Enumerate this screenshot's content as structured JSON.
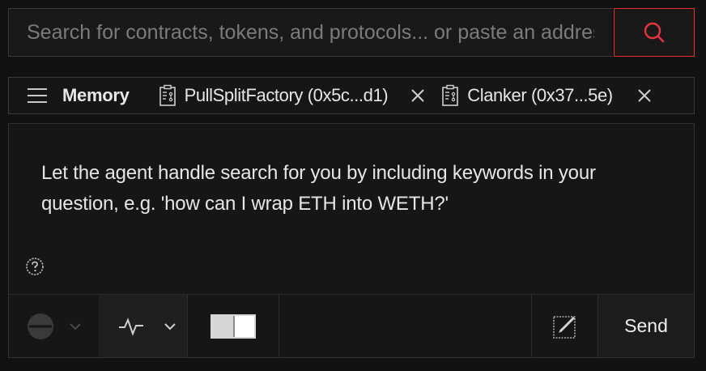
{
  "search": {
    "placeholder": "Search for contracts, tokens, and protocols... or paste an address",
    "value": ""
  },
  "tabs": {
    "memory_label": "Memory",
    "items": [
      {
        "label": "PullSplitFactory (0x5c...d1)"
      },
      {
        "label": "Clanker (0x37...5e)"
      }
    ]
  },
  "chat": {
    "hint": "Let the agent handle search for you by including keywords in your question, e.g. 'how can I wrap ETH into WETH?'",
    "send_label": "Send"
  },
  "colors": {
    "accent": "#e5333b",
    "background": "#121212",
    "panel": "#161616"
  },
  "icons": {
    "search": "search-icon",
    "menu": "menu-icon",
    "contract": "contract-icon",
    "close": "close-icon",
    "help": "help-icon",
    "activity": "activity-icon",
    "edit": "edit-icon"
  }
}
